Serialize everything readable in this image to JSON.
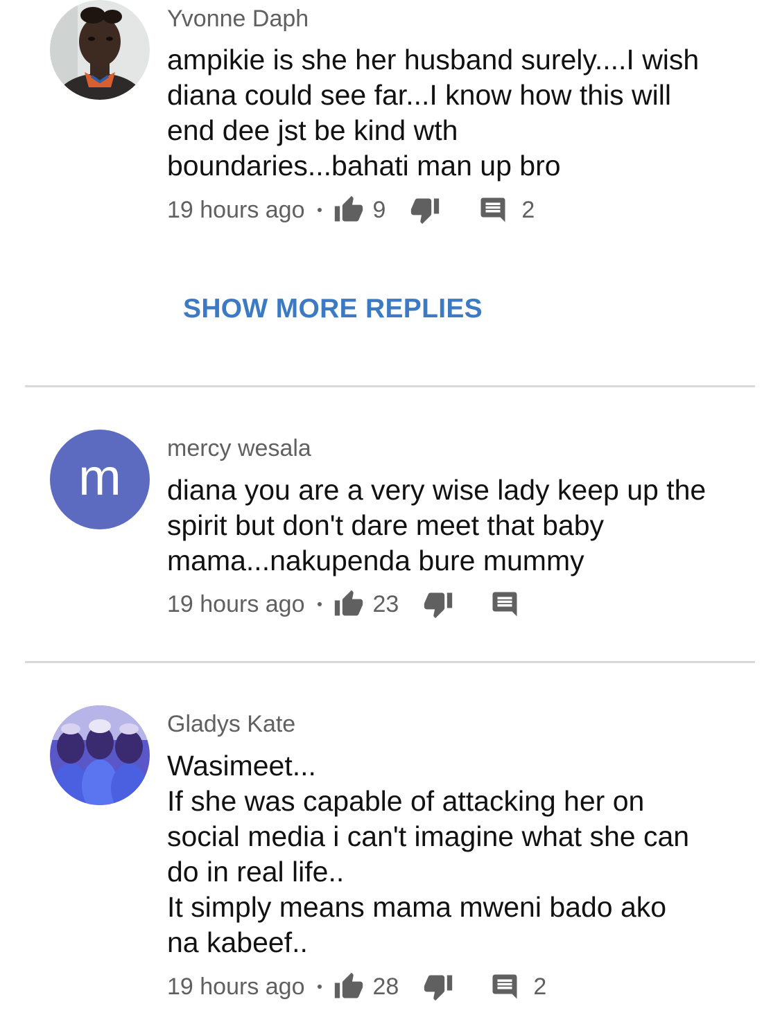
{
  "comments": [
    {
      "author": "Yvonne Daph",
      "lines": [
        "ampikie is she her husband surely....I wish",
        "diana could see far...I know how this will",
        "end dee jst be kind wth",
        "boundaries...bahati man up bro"
      ],
      "time": "19 hours ago",
      "likes": "9",
      "replies": "2"
    },
    {
      "author": "mercy wesala",
      "avatar_letter": "m",
      "lines": [
        "diana you are a very wise lady keep up the",
        "spirit but don't dare meet that baby",
        "mama...nakupenda bure mummy"
      ],
      "time": "19 hours ago",
      "likes": "23",
      "replies": ""
    },
    {
      "author": "Gladys Kate",
      "lines": [
        "Wasimeet...",
        "If she was capable of attacking her on",
        "social media i can't imagine what she can",
        "do in real life..",
        "It simply means mama mweni bado ako",
        "na kabeef.."
      ],
      "time": "19 hours ago",
      "likes": "28",
      "replies": "2"
    }
  ],
  "show_more_replies": "SHOW MORE REPLIES",
  "colors": {
    "link": "#3c7ac4",
    "letter_avatar": "#5c6bc0",
    "icon": "#606060"
  }
}
